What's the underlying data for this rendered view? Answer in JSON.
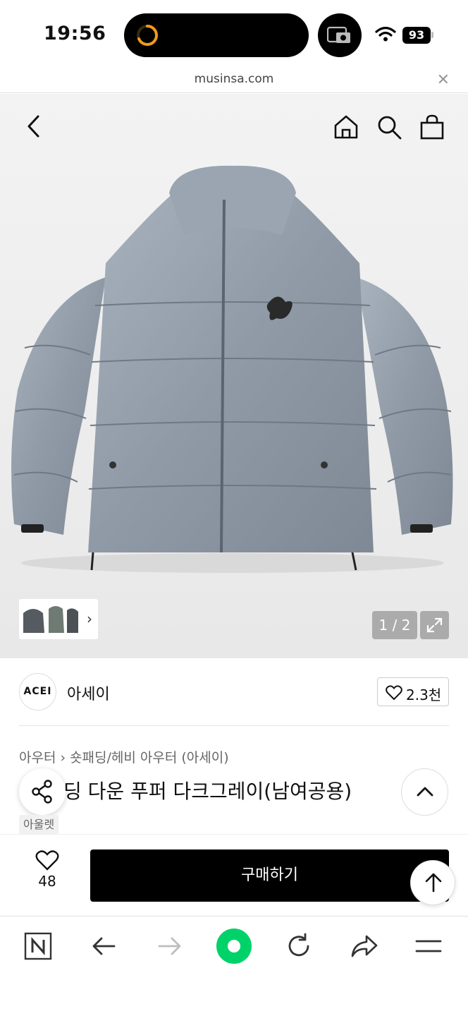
{
  "status_bar": {
    "time": "19:56",
    "battery": "93"
  },
  "browser": {
    "url": "musinsa.com",
    "close_icon": "✕"
  },
  "gallery": {
    "page_counter": "1 / 2",
    "current_page": 1,
    "total_pages": 2
  },
  "brand": {
    "logo_text": "ACEI",
    "name": "아세이",
    "likes": "2.3천"
  },
  "product": {
    "breadcrumb": [
      "아우터",
      "숏패딩/헤비 아우터 (아세이)"
    ],
    "title": "딩 다운 푸퍼 다크그레이(남여공용)",
    "badge": "아울렛"
  },
  "purchase": {
    "wish_count": "48",
    "buy_label": "구매하기"
  },
  "colors": {
    "accent": "#00d26a",
    "buy_button": "#000000"
  }
}
